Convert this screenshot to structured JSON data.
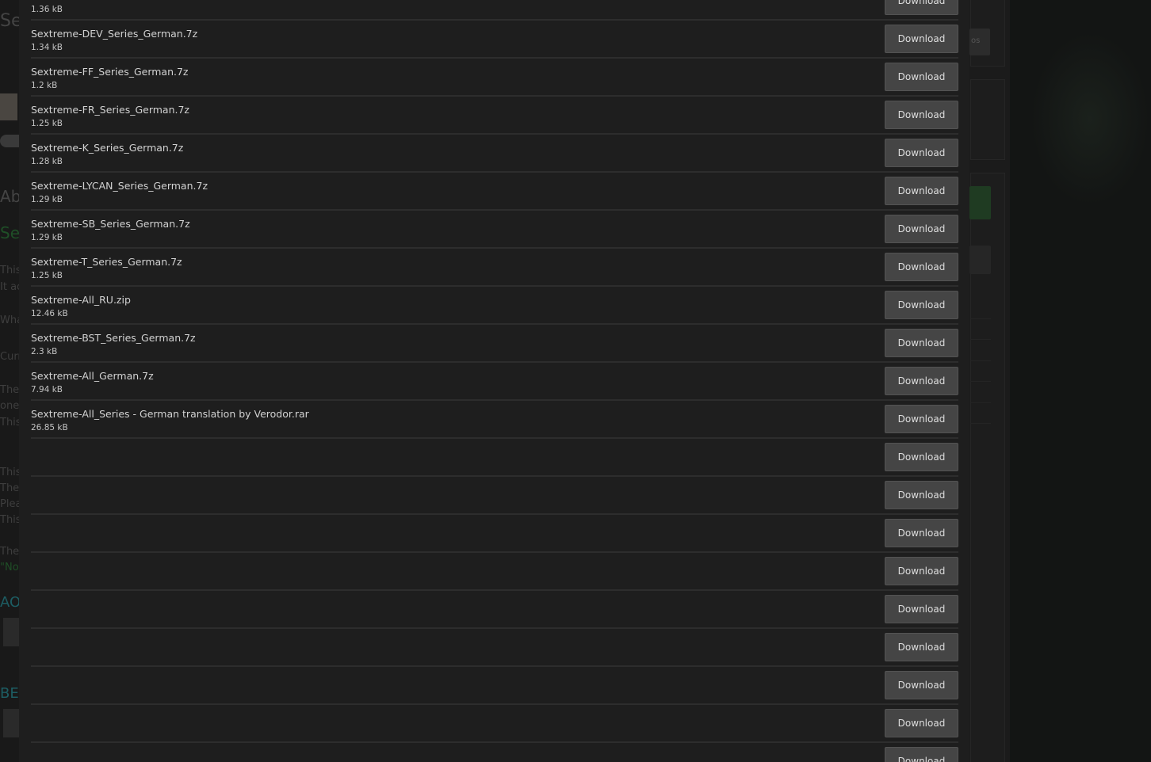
{
  "files": [
    {
      "name": "",
      "size": "1.36 kB"
    },
    {
      "name": "Sextreme-DEV_Series_German.7z",
      "size": "1.34 kB"
    },
    {
      "name": "Sextreme-FF_Series_German.7z",
      "size": "1.2 kB"
    },
    {
      "name": "Sextreme-FR_Series_German.7z",
      "size": "1.25 kB"
    },
    {
      "name": "Sextreme-K_Series_German.7z",
      "size": "1.28 kB"
    },
    {
      "name": "Sextreme-LYCAN_Series_German.7z",
      "size": "1.29 kB"
    },
    {
      "name": "Sextreme-SB_Series_German.7z",
      "size": "1.29 kB"
    },
    {
      "name": "Sextreme-T_Series_German.7z",
      "size": "1.25 kB"
    },
    {
      "name": "Sextreme-All_RU.zip",
      "size": "12.46 kB"
    },
    {
      "name": "Sextreme-BST_Series_German.7z",
      "size": "2.3 kB"
    },
    {
      "name": "Sextreme-All_German.7z",
      "size": "7.94 kB"
    },
    {
      "name": "Sextreme-All_Series - German translation by Verodor.rar",
      "size": "26.85 kB"
    },
    {
      "name": "",
      "size": ""
    },
    {
      "name": "",
      "size": ""
    },
    {
      "name": "",
      "size": ""
    },
    {
      "name": "",
      "size": ""
    },
    {
      "name": "",
      "size": ""
    },
    {
      "name": "",
      "size": ""
    },
    {
      "name": "",
      "size": ""
    },
    {
      "name": "",
      "size": ""
    },
    {
      "name": "",
      "size": ""
    }
  ],
  "download_label": "Download",
  "background": {
    "fragments": [
      "Se",
      "Ab",
      "Se",
      "This",
      "It ac",
      "Wha",
      "Curr",
      "The",
      "ones",
      "This",
      "This",
      "The",
      "Plea",
      "This",
      "The",
      "\"Not",
      "AO",
      "BEG"
    ],
    "side_button_text": "os"
  },
  "colors": {
    "page_bg": "#171717",
    "modal_bg": "#1e1e1e",
    "row_divider": "#2d2d2d",
    "button_bg": "#454545",
    "text": "#d2d2d2",
    "accent_green": "#1f5a2a",
    "accent_teal": "#1f6b72"
  }
}
